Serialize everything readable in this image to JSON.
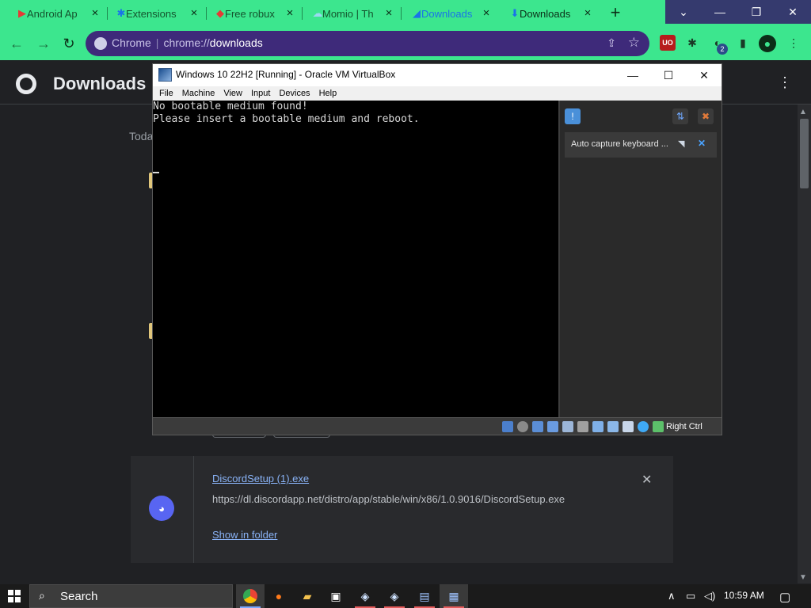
{
  "browser": {
    "tabs": [
      {
        "label": "Android Ap",
        "icon": "play-store-icon",
        "color": "#e53935"
      },
      {
        "label": "Extensions",
        "icon": "puzzle-icon",
        "color": "#1a73e8"
      },
      {
        "label": "Free robux",
        "icon": "roblox-icon",
        "color": "#e53935"
      },
      {
        "label": "Momio | Th",
        "icon": "cloud-icon",
        "color": "#9ad8f0"
      },
      {
        "label": "Downloads",
        "icon": "download-site-icon",
        "color": "#1a73e8"
      },
      {
        "label": "Downloads",
        "icon": "download-icon",
        "color": "#1a73e8"
      }
    ],
    "new_tab": "+",
    "window_controls": {
      "dropdown": "⌄",
      "minimize": "—",
      "restore": "❐",
      "close": "✕"
    },
    "omnibox": {
      "site": "Chrome",
      "separator": "|",
      "scheme": "chrome://",
      "path": "downloads"
    },
    "extension_badge": "2"
  },
  "downloads_page": {
    "title": "Downloads",
    "section": "Today",
    "item": {
      "filename": "DiscordSetup (1).exe",
      "url": "https://dl.discordapp.net/distro/app/stable/win/x86/1.0.9016/DiscordSetup.exe",
      "action": "Show in folder",
      "close": "✕"
    }
  },
  "virtualbox": {
    "title": "Windows 10 22H2 [Running] - Oracle VM VirtualBox",
    "menus": [
      "File",
      "Machine",
      "View",
      "Input",
      "Devices",
      "Help"
    ],
    "console_lines": [
      "No bootable medium found!",
      "Please insert a bootable medium and reboot."
    ],
    "notice": "Auto capture keyboard ...",
    "host_key": "Right Ctrl"
  },
  "taskbar": {
    "search_placeholder": "Search",
    "time": "10:59 AM"
  }
}
